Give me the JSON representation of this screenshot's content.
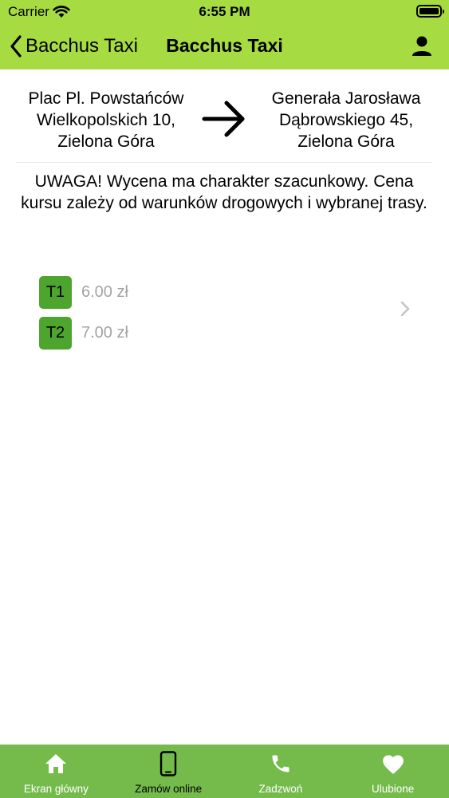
{
  "status_bar": {
    "carrier": "Carrier",
    "time": "6:55 PM"
  },
  "nav": {
    "back_label": "Bacchus Taxi",
    "title": "Bacchus Taxi"
  },
  "route": {
    "from_address": "Plac Pl. Powstańców Wielkopolskich 10, Zielona Góra",
    "to_address": "Generała Jarosława Dąbrowskiego 45, Zielona Góra"
  },
  "notice": "UWAGA! Wycena ma charakter szacunkowy. Cena kursu zależy od warunków drogowych i wybranej trasy.",
  "tariffs": [
    {
      "code": "T1",
      "price": "6.00 zł"
    },
    {
      "code": "T2",
      "price": "7.00 zł"
    }
  ],
  "tab_bar": {
    "active_tab": "Zamów online",
    "tabs": [
      {
        "label": "Ekran główny",
        "icon": "home-icon"
      },
      {
        "label": "Zamów online",
        "icon": "phone-device-icon"
      },
      {
        "label": "Zadzwoń",
        "icon": "call-icon"
      },
      {
        "label": "Ulubione",
        "icon": "heart-icon"
      }
    ]
  },
  "colors": {
    "header_background": "#a6dc42",
    "tab_bar_background": "#75bb4b",
    "tariff_badge": "#4da52e",
    "price_text": "#a3a3a3"
  }
}
